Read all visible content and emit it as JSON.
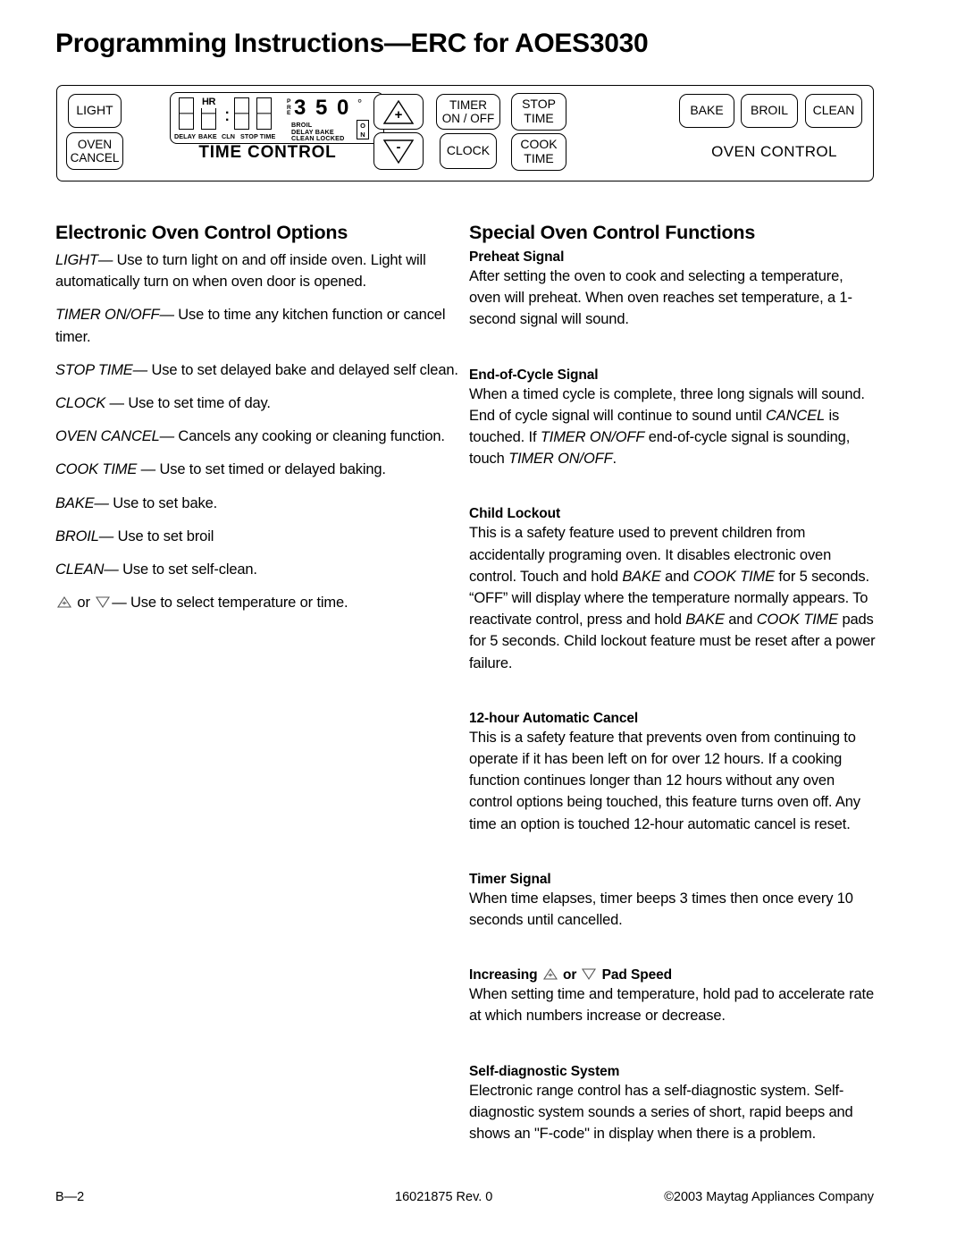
{
  "document": {
    "title": "Programming Instructions—ERC for AOES3030"
  },
  "control_panel": {
    "pads": {
      "light": "LIGHT",
      "oven": "OVEN",
      "cancel": "CANCEL",
      "up_arrow": "+",
      "down_arrow": "-",
      "timer": "TIMER",
      "on_off": "ON / OFF",
      "clock": "CLOCK",
      "stop": "STOP",
      "stop_time": "TIME",
      "cook": "COOK",
      "cook_time": "TIME",
      "bake": "BAKE",
      "broil": "BROIL",
      "clean": "CLEAN"
    },
    "time_control_label": "TIME CONTROL",
    "oven_control_label": "OVEN CONTROL",
    "lcd": {
      "hr_indicator": "HR",
      "temperature": "3 5 0",
      "degree": "°",
      "pre_indicator": [
        "P",
        "R",
        "E"
      ],
      "bottom_labels": [
        "DELAY",
        "BAKE",
        "CLN",
        "STOP TIME"
      ],
      "status_labels": [
        "BROIL",
        "DELAY BAKE",
        "CLEAN LOCKED"
      ],
      "on_indicator": [
        "O",
        "N"
      ]
    }
  },
  "left_column": {
    "heading": "Electronic Oven Control Options",
    "items": [
      {
        "keyword": "LIGHT",
        "dash": "—",
        "text": " Use to turn light on and off inside oven. Light will automatically turn on when oven door is opened."
      },
      {
        "keyword": "TIMER ON/OFF",
        "dash": "—",
        "text": " Use to time any kitchen function or cancel timer."
      },
      {
        "keyword": "STOP TIME",
        "dash": "—",
        "text": " Use to set delayed bake and delayed self clean."
      },
      {
        "keyword": "CLOCK ",
        "dash": "—",
        "text": " Use to set time of day."
      },
      {
        "keyword": "OVEN CANCEL",
        "dash": "—",
        "text": " Cancels any cooking or cleaning function."
      },
      {
        "keyword": "COOK TIME ",
        "dash": "—",
        "text": " Use to set timed or delayed baking."
      },
      {
        "keyword": "BAKE",
        "dash": "—",
        "text": " Use to set bake."
      },
      {
        "keyword": "BROIL",
        "dash": "—",
        "text": " Use to set broil"
      },
      {
        "keyword": "CLEAN",
        "dash": "—",
        "text": " Use to set self-clean."
      }
    ],
    "arrow_item": {
      "or": " or ",
      "dash": "—",
      "text": " Use to select temperature or time."
    }
  },
  "right_column": {
    "heading": "Special Oven Control Functions",
    "sections": [
      {
        "title": "Preheat  Signal",
        "body": "After setting the oven to cook and selecting a temperature, oven will preheat. When oven reaches set temperature, a 1-second signal will sound."
      },
      {
        "title": "End-of-Cycle Signal",
        "body_parts": {
          "p1": "When a timed cycle is complete, three long signals will sound. End of cycle signal will continue to sound until ",
          "kw1": "CANCEL",
          "p2": " is touched. If ",
          "kw2": "TIMER ON/OFF",
          "p3": " end-of-cycle signal is sounding, touch ",
          "kw3": "TIMER ON/OFF",
          "p4": "."
        }
      },
      {
        "title": "Child Lockout",
        "body_parts": {
          "p1": "This is a safety feature used to prevent children from accidentally programing oven. It disables electronic oven control. Touch and hold ",
          "kw1": "BAKE",
          "p2": " and ",
          "kw2": "COOK TIME",
          "p3": " for 5 seconds. “OFF” will display where the temperature normally appears. To reactivate control, press and hold ",
          "kw3": "BAKE",
          "p4": " and ",
          "kw4": "COOK TIME",
          "p5": " pads for 5 seconds. Child lockout feature must be reset after a power failure."
        }
      },
      {
        "title": "12-hour Automatic Cancel",
        "body": "This is a safety feature that prevents oven from continuing to operate if it has been left on for over 12 hours. If a cooking function continues longer than 12 hours without any oven control options being touched, this feature turns oven off. Any time an option is touched 12-hour automatic cancel is reset."
      },
      {
        "title": "Timer  Signal",
        "body": "When time elapses, timer beeps 3 times then once every 10 seconds until cancelled."
      },
      {
        "title_parts": {
          "a": "Increasing ",
          "or": " or ",
          "b": " Pad Speed"
        },
        "body": "When setting time and temperature, hold pad to accelerate rate at which numbers increase or decrease."
      },
      {
        "title": "Self-diagnostic System",
        "body": "Electronic range control has a self-diagnostic system. Self-diagnostic system sounds a series of short, rapid beeps and shows an \"F-code\" in display when there is a problem."
      }
    ]
  },
  "footer": {
    "page": "B—2",
    "part_number": "16021875  Rev. 0",
    "copyright": "©2003 Maytag Appliances Company"
  }
}
